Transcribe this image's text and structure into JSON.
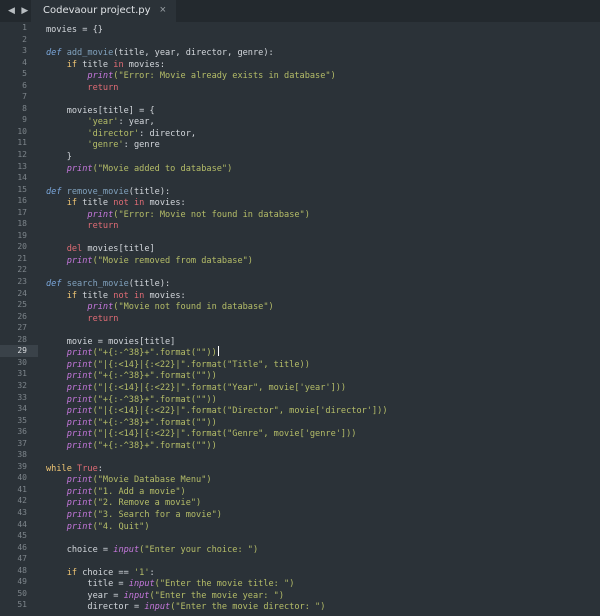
{
  "tabs": [
    {
      "label": "Codevaour project.py",
      "close": "×"
    }
  ],
  "nav": {
    "glyph": "◀ ▶"
  },
  "editor": {
    "current_line": 29,
    "line_numbers": [
      "1",
      "2",
      "3",
      "4",
      "5",
      "6",
      "7",
      "8",
      "9",
      "10",
      "11",
      "12",
      "13",
      "14",
      "15",
      "16",
      "17",
      "18",
      "19",
      "20",
      "21",
      "22",
      "23",
      "24",
      "25",
      "26",
      "27",
      "28",
      "29",
      "30",
      "31",
      "32",
      "33",
      "34",
      "35",
      "36",
      "37",
      "38",
      "39",
      "40",
      "41",
      "42",
      "43",
      "44",
      "45",
      "46",
      "47",
      "48",
      "49",
      "50",
      "51"
    ],
    "lines": [
      [
        {
          "t": "movies = {}",
          "c": "text"
        }
      ],
      [],
      [
        {
          "t": "def ",
          "c": "def"
        },
        {
          "t": "add_movie",
          "c": "fn"
        },
        {
          "t": "(title, year, director, genre):",
          "c": "text"
        }
      ],
      [
        {
          "t": "    if ",
          "c": "kw"
        },
        {
          "t": "title ",
          "c": "text"
        },
        {
          "t": "in ",
          "c": "kw2"
        },
        {
          "t": "movies:",
          "c": "text"
        }
      ],
      [
        {
          "t": "        ",
          "c": "text"
        },
        {
          "t": "print",
          "c": "print"
        },
        {
          "t": "(\"Error: Movie already exists in database\")",
          "c": "str"
        }
      ],
      [
        {
          "t": "        return",
          "c": "kw2"
        }
      ],
      [],
      [
        {
          "t": "    movies[title] = {",
          "c": "text"
        }
      ],
      [
        {
          "t": "        'year'",
          "c": "str"
        },
        {
          "t": ": year,",
          "c": "text"
        }
      ],
      [
        {
          "t": "        'director'",
          "c": "str"
        },
        {
          "t": ": director,",
          "c": "text"
        }
      ],
      [
        {
          "t": "        'genre'",
          "c": "str"
        },
        {
          "t": ": genre",
          "c": "text"
        }
      ],
      [
        {
          "t": "    }",
          "c": "text"
        }
      ],
      [
        {
          "t": "    ",
          "c": "text"
        },
        {
          "t": "print",
          "c": "print"
        },
        {
          "t": "(\"Movie added to database\")",
          "c": "str"
        }
      ],
      [],
      [
        {
          "t": "def ",
          "c": "def"
        },
        {
          "t": "remove_movie",
          "c": "fn"
        },
        {
          "t": "(title):",
          "c": "text"
        }
      ],
      [
        {
          "t": "    if ",
          "c": "kw"
        },
        {
          "t": "title ",
          "c": "text"
        },
        {
          "t": "not in ",
          "c": "kw2"
        },
        {
          "t": "movies:",
          "c": "text"
        }
      ],
      [
        {
          "t": "        ",
          "c": "text"
        },
        {
          "t": "print",
          "c": "print"
        },
        {
          "t": "(\"Error: Movie not found in database\")",
          "c": "str"
        }
      ],
      [
        {
          "t": "        return",
          "c": "kw2"
        }
      ],
      [],
      [
        {
          "t": "    del ",
          "c": "kw2"
        },
        {
          "t": "movies[title]",
          "c": "text"
        }
      ],
      [
        {
          "t": "    ",
          "c": "text"
        },
        {
          "t": "print",
          "c": "print"
        },
        {
          "t": "(\"Movie removed from database\")",
          "c": "str"
        }
      ],
      [],
      [
        {
          "t": "def ",
          "c": "def"
        },
        {
          "t": "search_movie",
          "c": "fn"
        },
        {
          "t": "(title):",
          "c": "text"
        }
      ],
      [
        {
          "t": "    if ",
          "c": "kw"
        },
        {
          "t": "title ",
          "c": "text"
        },
        {
          "t": "not in ",
          "c": "kw2"
        },
        {
          "t": "movies:",
          "c": "text"
        }
      ],
      [
        {
          "t": "        ",
          "c": "text"
        },
        {
          "t": "print",
          "c": "print"
        },
        {
          "t": "(\"Movie not found in database\")",
          "c": "str"
        }
      ],
      [
        {
          "t": "        return",
          "c": "kw2"
        }
      ],
      [],
      [
        {
          "t": "    movie = movies[title]",
          "c": "text"
        }
      ],
      [
        {
          "t": "    ",
          "c": "text"
        },
        {
          "t": "print",
          "c": "print"
        },
        {
          "t": "(\"+{:-^38}+\".format(\"\"))",
          "c": "str"
        }
      ],
      [
        {
          "t": "    ",
          "c": "text"
        },
        {
          "t": "print",
          "c": "print"
        },
        {
          "t": "(\"|{:<14}|{:<22}|\".format(\"Title\", title))",
          "c": "str"
        }
      ],
      [
        {
          "t": "    ",
          "c": "text"
        },
        {
          "t": "print",
          "c": "print"
        },
        {
          "t": "(\"+{:-^38}+\".format(\"\"))",
          "c": "str"
        }
      ],
      [
        {
          "t": "    ",
          "c": "text"
        },
        {
          "t": "print",
          "c": "print"
        },
        {
          "t": "(\"|{:<14}|{:<22}|\".format(\"Year\", movie['year']))",
          "c": "str"
        }
      ],
      [
        {
          "t": "    ",
          "c": "text"
        },
        {
          "t": "print",
          "c": "print"
        },
        {
          "t": "(\"+{:-^38}+\".format(\"\"))",
          "c": "str"
        }
      ],
      [
        {
          "t": "    ",
          "c": "text"
        },
        {
          "t": "print",
          "c": "print"
        },
        {
          "t": "(\"|{:<14}|{:<22}|\".format(\"Director\", movie['director']))",
          "c": "str"
        }
      ],
      [
        {
          "t": "    ",
          "c": "text"
        },
        {
          "t": "print",
          "c": "print"
        },
        {
          "t": "(\"+{:-^38}+\".format(\"\"))",
          "c": "str"
        }
      ],
      [
        {
          "t": "    ",
          "c": "text"
        },
        {
          "t": "print",
          "c": "print"
        },
        {
          "t": "(\"|{:<14}|{:<22}|\".format(\"Genre\", movie['genre']))",
          "c": "str"
        }
      ],
      [
        {
          "t": "    ",
          "c": "text"
        },
        {
          "t": "print",
          "c": "print"
        },
        {
          "t": "(\"+{:-^38}+\".format(\"\"))",
          "c": "str"
        }
      ],
      [],
      [
        {
          "t": "while ",
          "c": "kw"
        },
        {
          "t": "True",
          "c": "kw2"
        },
        {
          "t": ":",
          "c": "text"
        }
      ],
      [
        {
          "t": "    ",
          "c": "text"
        },
        {
          "t": "print",
          "c": "print"
        },
        {
          "t": "(\"Movie Database Menu\")",
          "c": "str"
        }
      ],
      [
        {
          "t": "    ",
          "c": "text"
        },
        {
          "t": "print",
          "c": "print"
        },
        {
          "t": "(\"1. Add a movie\")",
          "c": "str"
        }
      ],
      [
        {
          "t": "    ",
          "c": "text"
        },
        {
          "t": "print",
          "c": "print"
        },
        {
          "t": "(\"2. Remove a movie\")",
          "c": "str"
        }
      ],
      [
        {
          "t": "    ",
          "c": "text"
        },
        {
          "t": "print",
          "c": "print"
        },
        {
          "t": "(\"3. Search for a movie\")",
          "c": "str"
        }
      ],
      [
        {
          "t": "    ",
          "c": "text"
        },
        {
          "t": "print",
          "c": "print"
        },
        {
          "t": "(\"4. Quit\")",
          "c": "str"
        }
      ],
      [],
      [
        {
          "t": "    choice = ",
          "c": "text"
        },
        {
          "t": "input",
          "c": "print"
        },
        {
          "t": "(\"Enter your choice: \")",
          "c": "str"
        }
      ],
      [],
      [
        {
          "t": "    if ",
          "c": "kw"
        },
        {
          "t": "choice == ",
          "c": "text"
        },
        {
          "t": "'1'",
          "c": "str"
        },
        {
          "t": ":",
          "c": "text"
        }
      ],
      [
        {
          "t": "        title = ",
          "c": "text"
        },
        {
          "t": "input",
          "c": "print"
        },
        {
          "t": "(\"Enter the movie title: \")",
          "c": "str"
        }
      ],
      [
        {
          "t": "        year = ",
          "c": "text"
        },
        {
          "t": "input",
          "c": "print"
        },
        {
          "t": "(\"Enter the movie year: \")",
          "c": "str"
        }
      ],
      [
        {
          "t": "        director = ",
          "c": "text"
        },
        {
          "t": "input",
          "c": "print"
        },
        {
          "t": "(\"Enter the movie director: \")",
          "c": "str"
        }
      ]
    ]
  },
  "colors": {
    "background": "#2b3238",
    "tabbar": "#23292e",
    "current_line": "#3a4249",
    "keyword": "#f0c674",
    "string": "#b5bd68",
    "print": "#c678dd",
    "function": "#81a2be"
  }
}
